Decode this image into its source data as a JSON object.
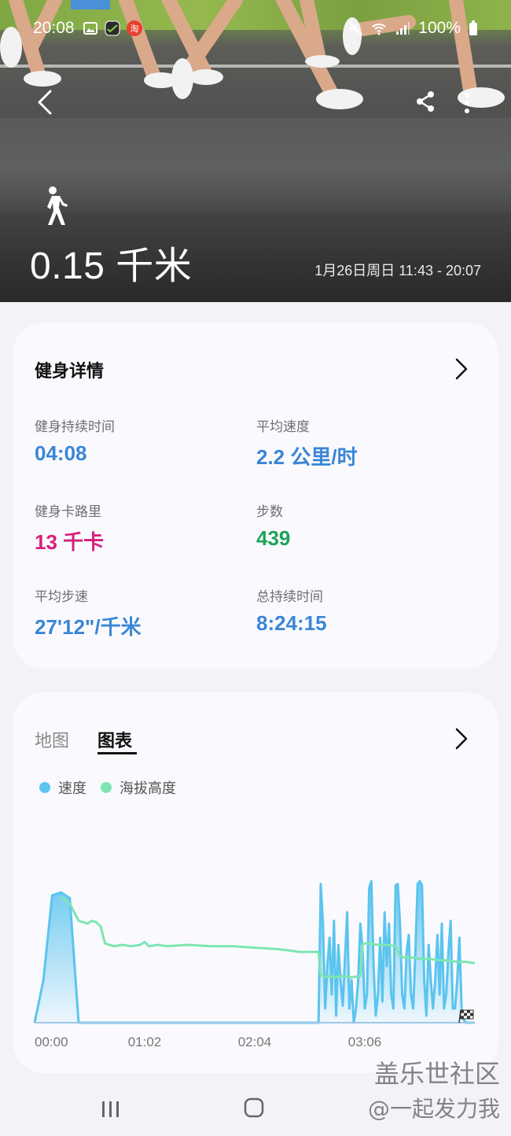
{
  "status_bar": {
    "time": "20:08",
    "battery": "100%"
  },
  "hero": {
    "activity_icon": "walking-person-icon",
    "distance": "0.15 千米",
    "date_range": "1月26日周日 11:43 - 20:07"
  },
  "details": {
    "title": "健身详情",
    "stats": [
      {
        "label": "健身持续时间",
        "value": "04:08"
      },
      {
        "label": "平均速度",
        "value": "2.2 公里/时"
      },
      {
        "label": "健身卡路里",
        "value": "13 千卡"
      },
      {
        "label": "步数",
        "value": "439"
      },
      {
        "label": "平均步速",
        "value": "27'12\"/千米"
      },
      {
        "label": "总持续时间",
        "value": "8:24:15"
      }
    ]
  },
  "chart_card": {
    "tab_map": "地图",
    "tab_chart": "图表",
    "legend_speed": "速度",
    "legend_altitude": "海拔高度"
  },
  "colors": {
    "speed": "#5bc4ef",
    "altitude": "#7de6b0",
    "blue_value": "#3a86d6",
    "pink_value": "#d61f7b",
    "green_value": "#1fa35a"
  },
  "chart_data": {
    "type": "area",
    "x_ticks": [
      "00:00",
      "01:02",
      "02:04",
      "03:06"
    ],
    "end_marker": "finish-flag-icon",
    "series": [
      {
        "name": "速度",
        "x": [
          0,
          0.02,
          0.04,
          0.06,
          0.08,
          0.1,
          0.12,
          0.14,
          0.16,
          0.18,
          0.2,
          0.22,
          0.24,
          0.26,
          0.28,
          0.3,
          0.32,
          0.34,
          0.36,
          0.38,
          0.4,
          0.42,
          0.44,
          0.46,
          0.48,
          0.5,
          0.52,
          0.54,
          0.56,
          0.58,
          0.6,
          0.62,
          0.64,
          0.645,
          0.65,
          0.655,
          0.66,
          0.665,
          0.67,
          0.675,
          0.68,
          0.685,
          0.69,
          0.695,
          0.7,
          0.705,
          0.71,
          0.715,
          0.72,
          0.725,
          0.73,
          0.735,
          0.74,
          0.745,
          0.75,
          0.755,
          0.76,
          0.765,
          0.77,
          0.775,
          0.78,
          0.785,
          0.79,
          0.795,
          0.8,
          0.805,
          0.81,
          0.815,
          0.82,
          0.825,
          0.83,
          0.835,
          0.84,
          0.845,
          0.85,
          0.855,
          0.86,
          0.865,
          0.87,
          0.875,
          0.88,
          0.885,
          0.89,
          0.895,
          0.9,
          0.905,
          0.91,
          0.915,
          0.92,
          0.925,
          0.93,
          0.935,
          0.94,
          0.945,
          0.95,
          0.955,
          0.96,
          0.965,
          0.97,
          0.975,
          0.98,
          0.985,
          0.99,
          0.995,
          1
        ],
        "values": [
          0,
          0.3,
          0.9,
          0.92,
          0.88,
          0,
          0,
          0,
          0,
          0,
          0,
          0,
          0,
          0,
          0,
          0,
          0,
          0,
          0,
          0,
          0,
          0,
          0,
          0,
          0,
          0,
          0,
          0,
          0,
          0,
          0,
          0,
          0,
          0,
          0.98,
          0.7,
          0.1,
          0.4,
          0.6,
          0.2,
          0.72,
          0.05,
          0.55,
          0.3,
          0.12,
          0.45,
          0.78,
          0.1,
          0.3,
          0.0,
          0.1,
          0.3,
          0.7,
          0.52,
          0.1,
          0.2,
          0.95,
          1.0,
          0.4,
          0.05,
          0.2,
          0.6,
          0.15,
          0.78,
          0.4,
          0.7,
          0.2,
          0.1,
          0.97,
          0.98,
          0.7,
          0.2,
          0.1,
          0.5,
          0.62,
          0.2,
          0.1,
          0.5,
          0.98,
          1.0,
          0.97,
          0.3,
          0.05,
          0.55,
          0.3,
          0.1,
          0.3,
          0.62,
          0.2,
          0.7,
          0.1,
          0.2,
          0.5,
          0.72,
          0.1,
          0.1,
          0.3,
          0.6,
          0.1,
          0.02,
          0,
          0,
          0,
          0,
          0
        ],
        "ylim": [
          0,
          1
        ]
      },
      {
        "name": "海拔高度",
        "x": [
          0.06,
          0.07,
          0.08,
          0.09,
          0.1,
          0.11,
          0.12,
          0.13,
          0.14,
          0.15,
          0.16,
          0.18,
          0.2,
          0.22,
          0.24,
          0.25,
          0.26,
          0.28,
          0.3,
          0.35,
          0.4,
          0.45,
          0.5,
          0.55,
          0.58,
          0.6,
          0.62,
          0.64,
          0.645,
          0.65,
          0.66,
          0.67,
          0.68,
          0.7,
          0.72,
          0.74,
          0.745,
          0.75,
          0.76,
          0.78,
          0.8,
          0.82,
          0.83,
          0.84,
          0.86,
          0.88,
          0.9,
          0.92,
          0.94,
          0.96,
          0.98,
          1
        ],
        "values": [
          0.88,
          0.87,
          0.84,
          0.78,
          0.72,
          0.71,
          0.7,
          0.72,
          0.71,
          0.68,
          0.56,
          0.54,
          0.55,
          0.54,
          0.55,
          0.57,
          0.54,
          0.55,
          0.54,
          0.55,
          0.54,
          0.54,
          0.53,
          0.52,
          0.51,
          0.5,
          0.5,
          0.5,
          0.5,
          0.34,
          0.32,
          0.33,
          0.32,
          0.33,
          0.32,
          0.33,
          0.55,
          0.56,
          0.56,
          0.55,
          0.55,
          0.54,
          0.47,
          0.46,
          0.46,
          0.45,
          0.45,
          0.44,
          0.44,
          0.43,
          0.43,
          0.42
        ],
        "ylim": [
          0,
          1
        ]
      }
    ]
  }
}
